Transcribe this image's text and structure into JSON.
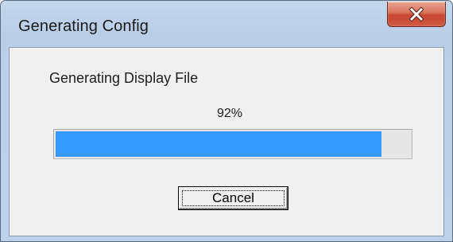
{
  "window": {
    "title": "Generating Config"
  },
  "titlebar": {
    "close_icon": "close-icon"
  },
  "dialog": {
    "status_text": "Generating Display File",
    "percent_text": "92%",
    "progress": 0.92,
    "progress_color": "#3399ff",
    "cancel_label": "Cancel"
  }
}
